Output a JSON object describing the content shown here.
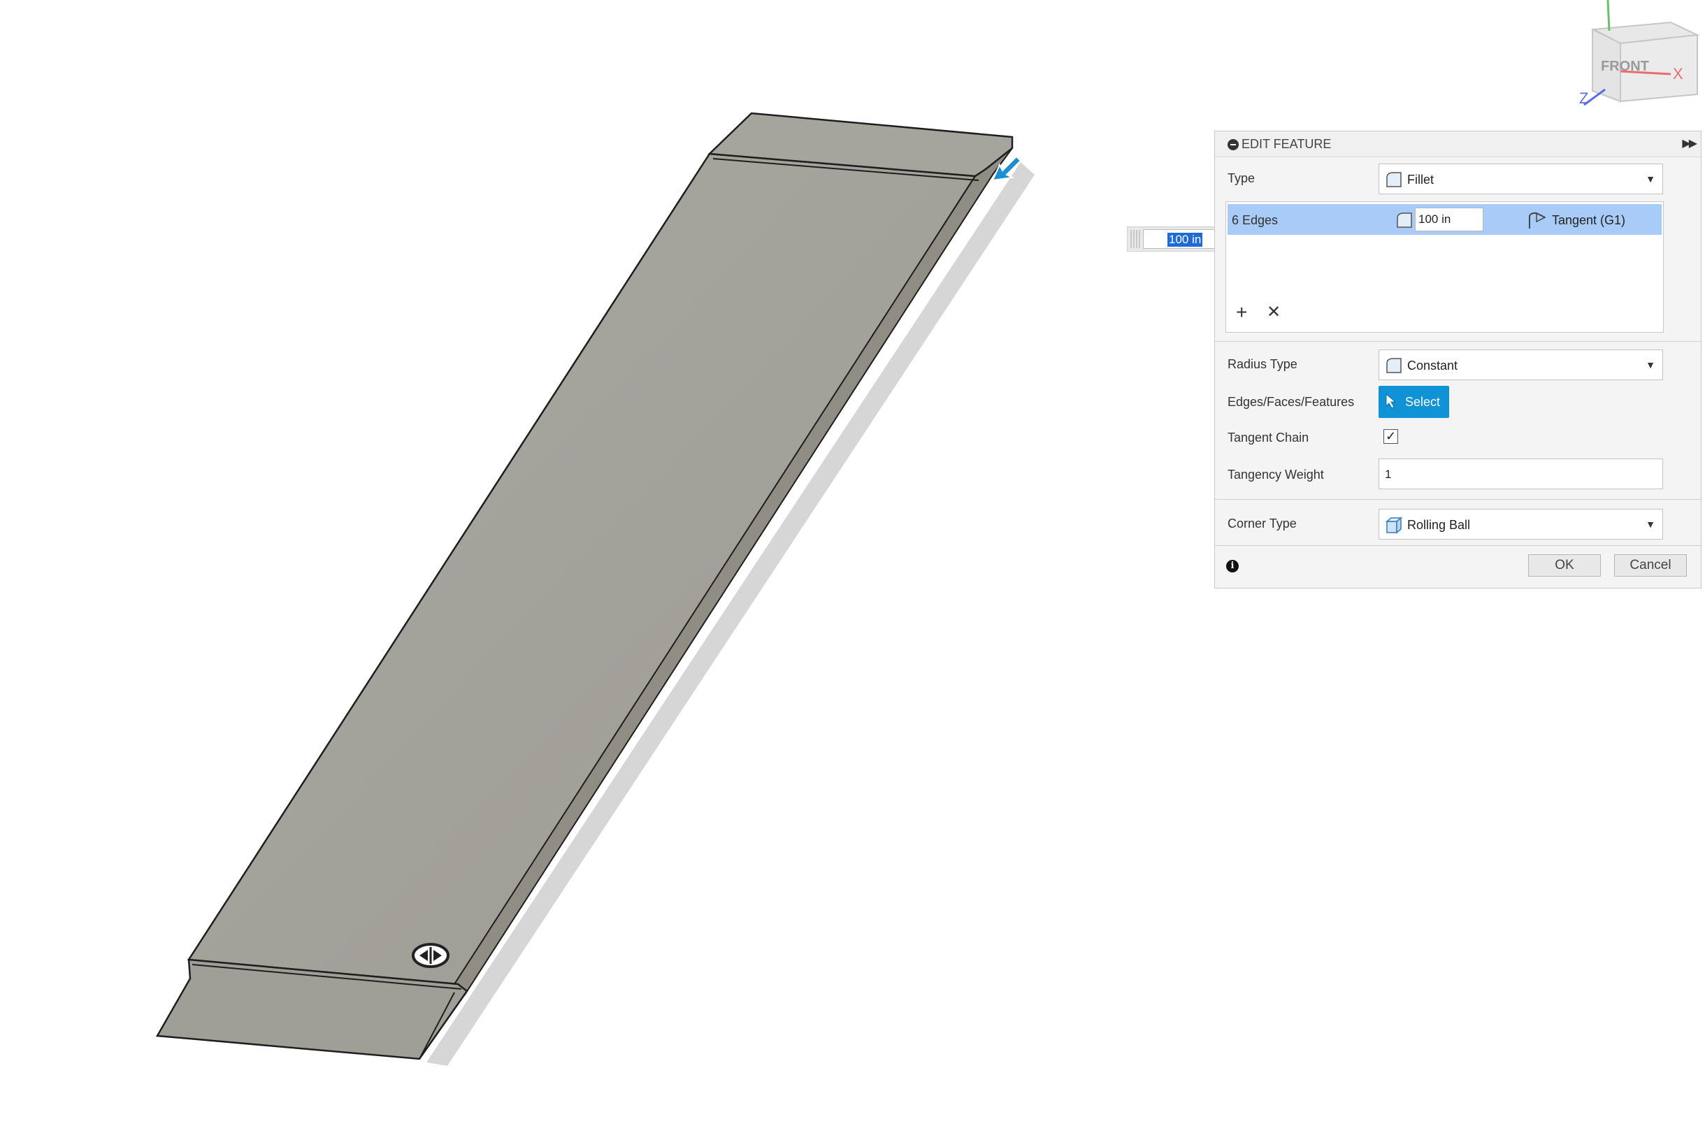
{
  "viewport": {
    "viewcube_face": "FRONT",
    "axes": {
      "x": "X",
      "z": "Z"
    }
  },
  "inline_radius": {
    "value": "100 in"
  },
  "panel": {
    "title": "EDIT FEATURE",
    "type": {
      "label": "Type",
      "value": "Fillet"
    },
    "edge_row": {
      "edges": "6 Edges",
      "radius": "100 in",
      "continuity": "Tangent (G1)"
    },
    "radius_type": {
      "label": "Radius Type",
      "value": "Constant"
    },
    "selection": {
      "label": "Edges/Faces/Features",
      "button": "Select"
    },
    "tangent_chain": {
      "label": "Tangent Chain",
      "checked": true
    },
    "tangency_weight": {
      "label": "Tangency Weight",
      "value": "1"
    },
    "corner_type": {
      "label": "Corner Type",
      "value": "Rolling Ball"
    },
    "ok": "OK",
    "cancel": "Cancel"
  },
  "colors": {
    "accent": "#0f93d6",
    "selection_row": "#a8cbf7",
    "body_top": "#a3a39c",
    "body_side": "#8f8d84"
  }
}
